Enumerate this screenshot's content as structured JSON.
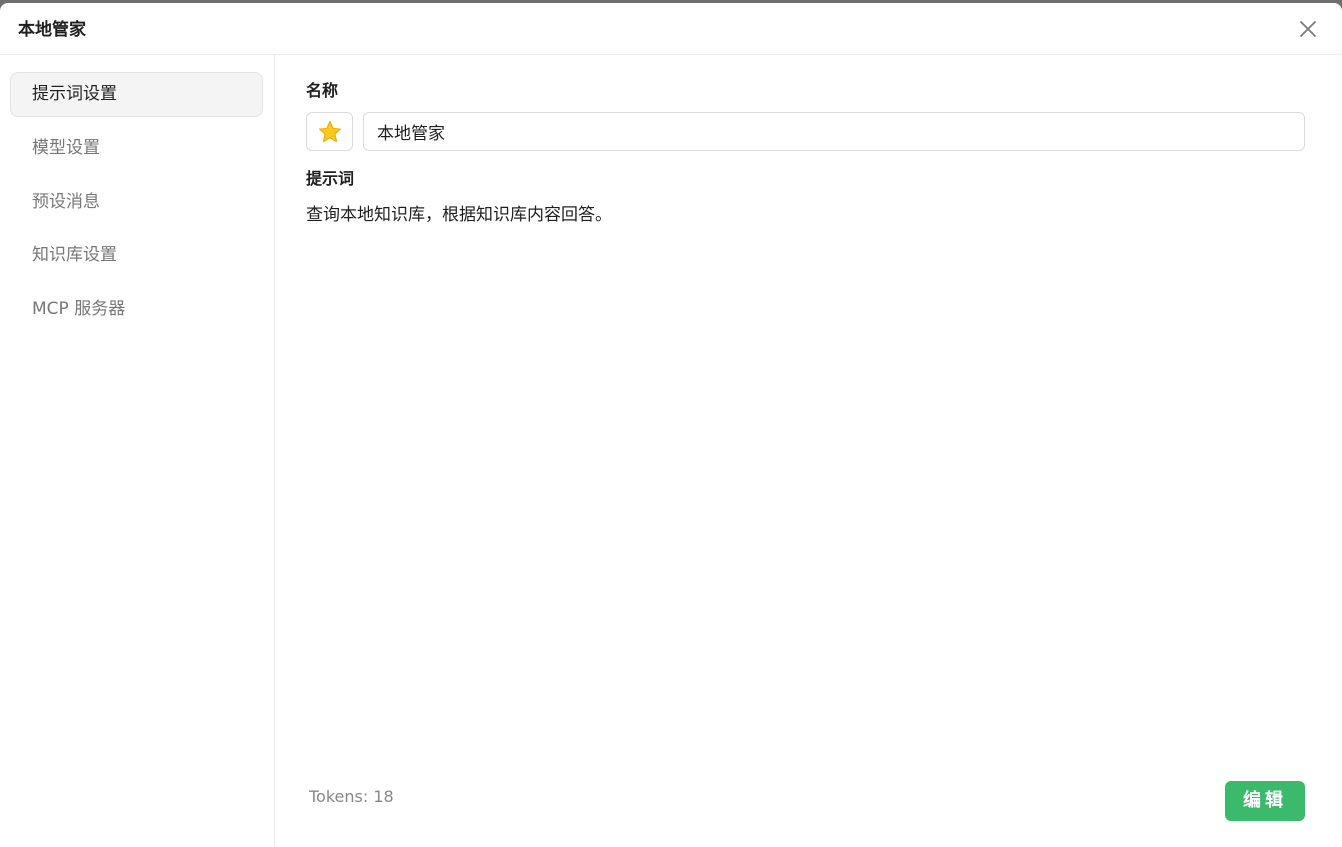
{
  "dialog": {
    "title": "本地管家",
    "close_icon": "close-icon"
  },
  "sidebar": {
    "items": [
      {
        "label": "提示词设置",
        "active": true
      },
      {
        "label": "模型设置",
        "active": false
      },
      {
        "label": "预设消息",
        "active": false
      },
      {
        "label": "知识库设置",
        "active": false
      },
      {
        "label": "MCP 服务器",
        "active": false
      }
    ]
  },
  "form": {
    "name_label": "名称",
    "emoji_icon": "star-icon",
    "name_value": "本地管家",
    "prompt_label": "提示词",
    "prompt_text": "查询本地知识库，根据知识库内容回答。"
  },
  "footer": {
    "tokens": "Tokens: 18",
    "edit_label": "编辑"
  },
  "colors": {
    "accent": "#3cba6c",
    "star": "#f8c81c"
  }
}
